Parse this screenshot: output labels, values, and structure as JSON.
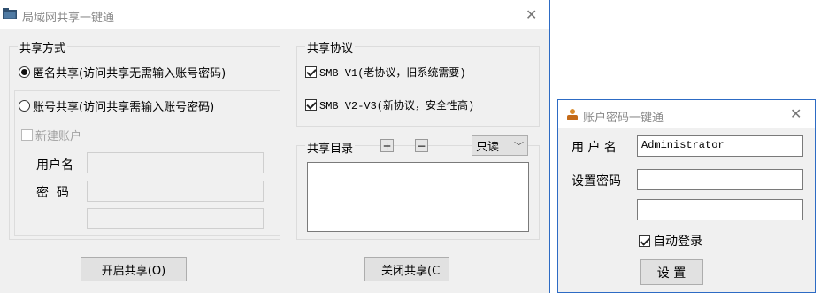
{
  "main_window": {
    "title": "局域网共享一键通",
    "share_mode": {
      "legend": "共享方式",
      "anonymous_label": "匿名共享(访问共享无需输入账号密码)",
      "anonymous_selected": true,
      "account_label": "账号共享(访问共享需输入账号密码)",
      "account_selected": false,
      "new_account_label": "新建账户",
      "username_label": "用户名",
      "password_label": "密  码",
      "username_value": "",
      "password_value": "",
      "confirm_value": ""
    },
    "protocol": {
      "legend": "共享协议",
      "smb1_label": "SMB V1(老协议，旧系统需要)",
      "smb1_checked": true,
      "smb23_label": "SMB V2-V3(新协议，安全性高)",
      "smb23_checked": true
    },
    "share_dir": {
      "legend": "共享目录",
      "add_label": "+",
      "remove_label": "−",
      "permission_selected": "只读"
    },
    "start_button": "开启共享(O)",
    "stop_button": "关闭共享(C"
  },
  "login_window": {
    "title": "账户密码一键通",
    "username_label": "用 户 名",
    "username_value": "Administrator",
    "password_label": "设置密码",
    "password_value": "",
    "confirm_value": "",
    "autologin_label": "自动登录",
    "autologin_checked": true,
    "set_button": "设 置"
  },
  "colors": {
    "window_bg": "#f0f0f0",
    "titlebar_bg": "#ffffff",
    "border_accent": "#2d6bc4",
    "disabled_text": "#a0a0a0"
  },
  "icons": {
    "main_title_icon": "folder-icon",
    "login_title_icon": "user-icon",
    "close_icon": "close-icon",
    "dropdown_icon": "chevron-down-icon"
  }
}
